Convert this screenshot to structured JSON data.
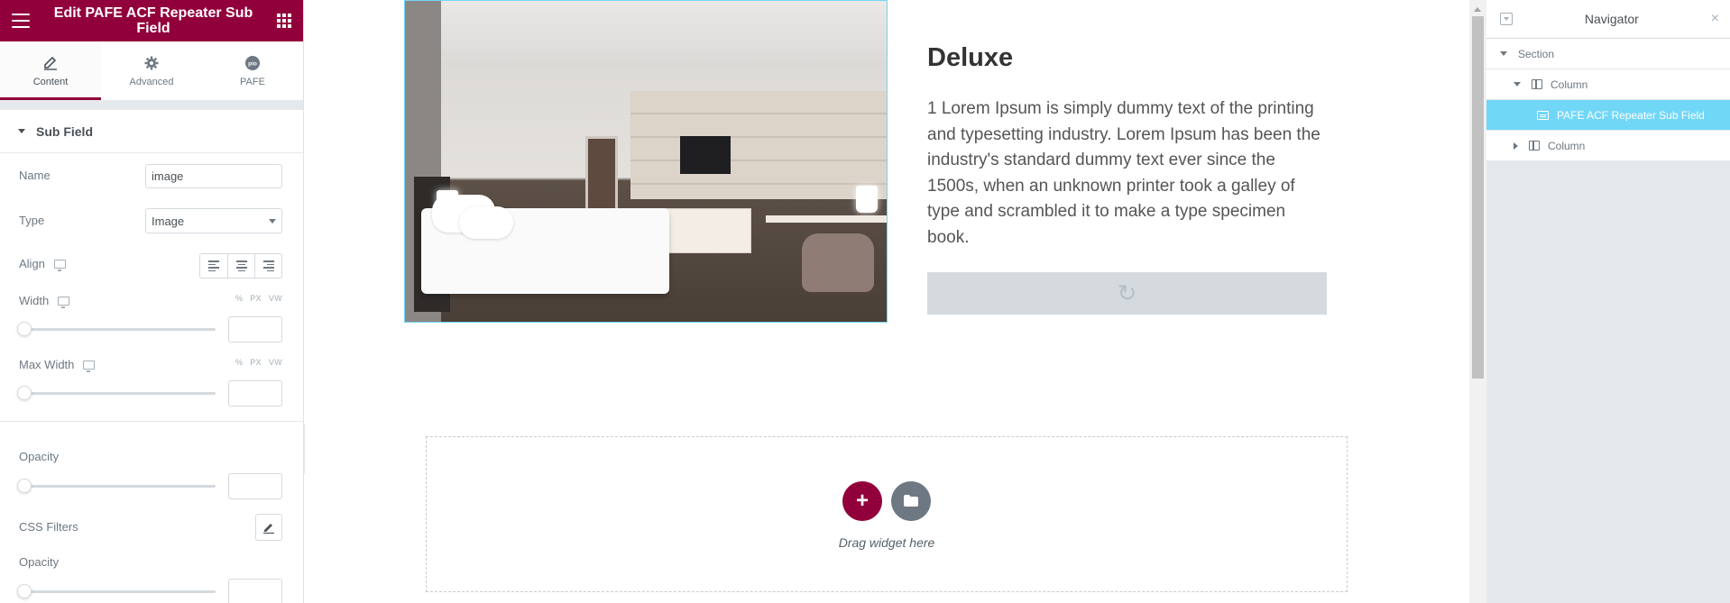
{
  "panel": {
    "title": "Edit PAFE ACF Repeater Sub Field",
    "tabs": [
      {
        "label": "Content",
        "icon": "pencil-icon"
      },
      {
        "label": "Advanced",
        "icon": "gear-icon"
      },
      {
        "label": "PAFE",
        "icon": "pafe-logo-icon",
        "badge": "pio"
      }
    ],
    "section_title": "Sub Field",
    "controls": {
      "name_label": "Name",
      "name_value": "image",
      "type_label": "Type",
      "type_value": "Image",
      "align_label": "Align",
      "width_label": "Width",
      "max_width_label": "Max Width",
      "units": [
        "PX",
        "VW"
      ],
      "opacity_label": "Opacity",
      "css_filters_label": "CSS Filters",
      "opacity2_label": "Opacity"
    },
    "collapse_arrow": "‹"
  },
  "canvas": {
    "heading": "Deluxe",
    "body": "1 Lorem Ipsum is simply dummy text of the printing and typesetting industry. Lorem Ipsum has been the industry's standard dummy text ever since the 1500s, when an unknown printer took a galley of type and scrambled it to make a type specimen book.",
    "loading_glyph": "↻",
    "add_glyph": "+",
    "drop_label": "Drag widget here"
  },
  "navigator": {
    "title": "Navigator",
    "close": "×",
    "items": [
      {
        "label": "Section"
      },
      {
        "label": "Column"
      },
      {
        "label": "PAFE ACF Repeater Sub Field"
      },
      {
        "label": "Column"
      }
    ]
  },
  "colors": {
    "brand": "#92003b",
    "highlight": "#71d7f7"
  }
}
